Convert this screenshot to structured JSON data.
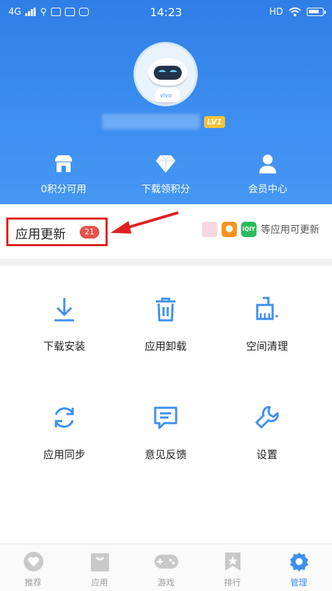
{
  "status_bar": {
    "network": "4G",
    "time": "14:23",
    "hd": "HD"
  },
  "profile": {
    "level_badge": "LV1",
    "avatar_text": "vivo"
  },
  "quick_actions": [
    {
      "label": "0积分可用",
      "icon": "store-icon"
    },
    {
      "label": "下载领积分",
      "icon": "diamond-icon"
    },
    {
      "label": "会员中心",
      "icon": "person-icon"
    }
  ],
  "updates": {
    "title": "应用更新",
    "count": "21",
    "suffix": "等应用可更新",
    "app_icon_text": "iQIY"
  },
  "grid": [
    {
      "label": "下载安装",
      "icon": "download-icon"
    },
    {
      "label": "应用卸载",
      "icon": "trash-icon"
    },
    {
      "label": "空间清理",
      "icon": "clean-icon"
    },
    {
      "label": "应用同步",
      "icon": "sync-icon"
    },
    {
      "label": "意见反馈",
      "icon": "feedback-icon"
    },
    {
      "label": "设置",
      "icon": "wrench-icon"
    }
  ],
  "bottom_nav": [
    {
      "label": "推荐",
      "icon": "heart-icon"
    },
    {
      "label": "应用",
      "icon": "bag-icon"
    },
    {
      "label": "游戏",
      "icon": "gamepad-icon"
    },
    {
      "label": "排行",
      "icon": "bookmark-icon"
    },
    {
      "label": "管理",
      "icon": "gear-icon",
      "active": true
    }
  ],
  "colors": {
    "brand_blue": "#3d8ff0",
    "highlight_red": "#e02020",
    "badge_red": "#e85248"
  }
}
